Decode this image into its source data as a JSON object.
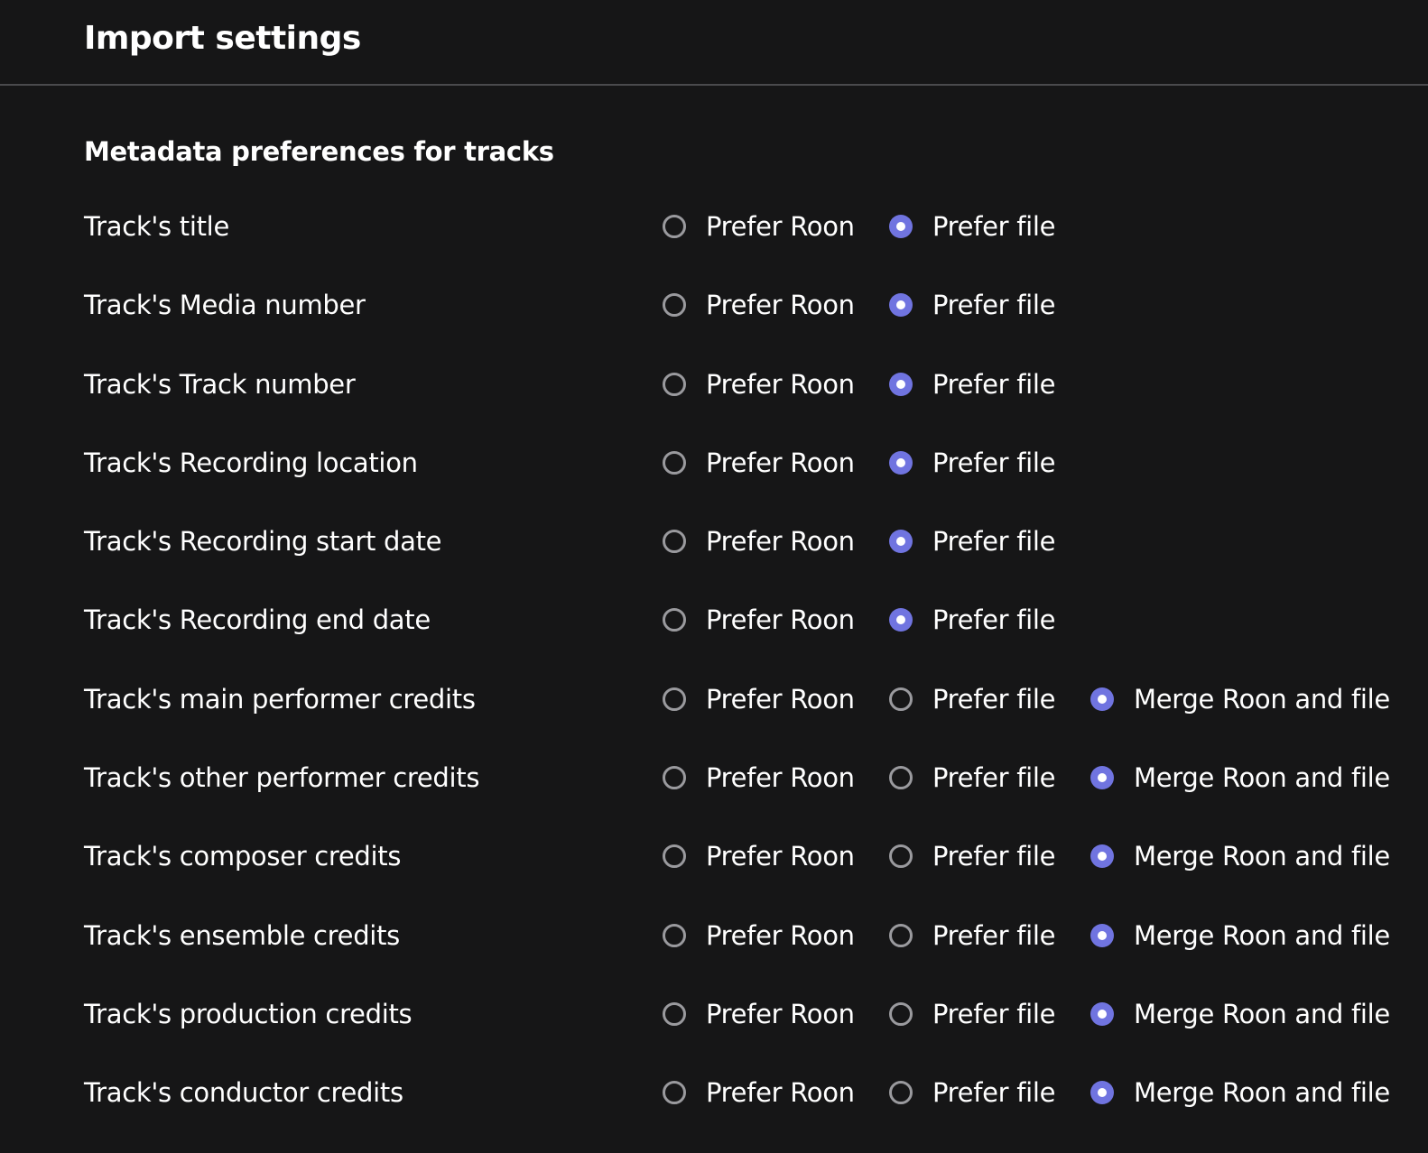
{
  "header": {
    "title": "Import settings"
  },
  "section": {
    "title": "Metadata preferences for tracks"
  },
  "colors": {
    "accent": "#7074e0",
    "background": "#161617",
    "radio_unchecked": "#9a9a9e"
  },
  "rows": [
    {
      "label": "Track's title",
      "options": [
        {
          "label": "Prefer Roon",
          "checked": false
        },
        {
          "label": "Prefer file",
          "checked": true
        }
      ]
    },
    {
      "label": "Track's Media number",
      "options": [
        {
          "label": "Prefer Roon",
          "checked": false
        },
        {
          "label": "Prefer file",
          "checked": true
        }
      ]
    },
    {
      "label": "Track's Track number",
      "options": [
        {
          "label": "Prefer Roon",
          "checked": false
        },
        {
          "label": "Prefer file",
          "checked": true
        }
      ]
    },
    {
      "label": "Track's Recording location",
      "options": [
        {
          "label": "Prefer Roon",
          "checked": false
        },
        {
          "label": "Prefer file",
          "checked": true
        }
      ]
    },
    {
      "label": "Track's Recording start date",
      "options": [
        {
          "label": "Prefer Roon",
          "checked": false
        },
        {
          "label": "Prefer file",
          "checked": true
        }
      ]
    },
    {
      "label": "Track's Recording end date",
      "options": [
        {
          "label": "Prefer Roon",
          "checked": false
        },
        {
          "label": "Prefer file",
          "checked": true
        }
      ]
    },
    {
      "label": "Track's main performer credits",
      "options": [
        {
          "label": "Prefer Roon",
          "checked": false
        },
        {
          "label": "Prefer file",
          "checked": false
        },
        {
          "label": "Merge Roon and file",
          "checked": true
        }
      ]
    },
    {
      "label": "Track's other performer credits",
      "options": [
        {
          "label": "Prefer Roon",
          "checked": false
        },
        {
          "label": "Prefer file",
          "checked": false
        },
        {
          "label": "Merge Roon and file",
          "checked": true
        }
      ]
    },
    {
      "label": "Track's composer credits",
      "options": [
        {
          "label": "Prefer Roon",
          "checked": false
        },
        {
          "label": "Prefer file",
          "checked": false
        },
        {
          "label": "Merge Roon and file",
          "checked": true
        }
      ]
    },
    {
      "label": "Track's ensemble credits",
      "options": [
        {
          "label": "Prefer Roon",
          "checked": false
        },
        {
          "label": "Prefer file",
          "checked": false
        },
        {
          "label": "Merge Roon and file",
          "checked": true
        }
      ]
    },
    {
      "label": "Track's production credits",
      "options": [
        {
          "label": "Prefer Roon",
          "checked": false
        },
        {
          "label": "Prefer file",
          "checked": false
        },
        {
          "label": "Merge Roon and file",
          "checked": true
        }
      ]
    },
    {
      "label": "Track's conductor credits",
      "options": [
        {
          "label": "Prefer Roon",
          "checked": false
        },
        {
          "label": "Prefer file",
          "checked": false
        },
        {
          "label": "Merge Roon and file",
          "checked": true
        }
      ]
    }
  ]
}
